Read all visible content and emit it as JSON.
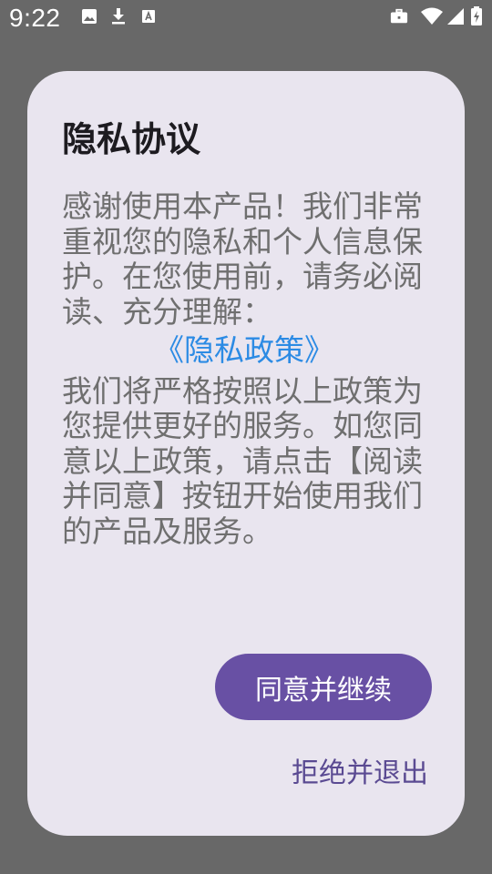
{
  "status_bar": {
    "time": "9:22",
    "left_icons": [
      "image-icon",
      "download-icon",
      "font-icon"
    ],
    "right_icons": [
      "briefcase-icon",
      "wifi-icon",
      "signal-icon",
      "battery-charging-icon"
    ]
  },
  "dialog": {
    "title": "隐私协议",
    "intro": "感谢使用本产品！我们非常重视您的隐私和个人信息保护。在您使用前，请务必阅读、充分理解：",
    "policy_link": "《隐私政策》",
    "outro": "我们将严格按照以上政策为您提供更好的服务。如您同意以上政策，请点击【阅读并同意】按钮开始使用我们的产品及服务。",
    "agree_button": "同意并继续",
    "exit_button": "拒绝并退出"
  },
  "colors": {
    "backdrop": "#686868",
    "dialog_bg": "#e9e5ef",
    "primary": "#6850a4",
    "link": "#2c8be4",
    "body_text": "#6f6f6f"
  }
}
